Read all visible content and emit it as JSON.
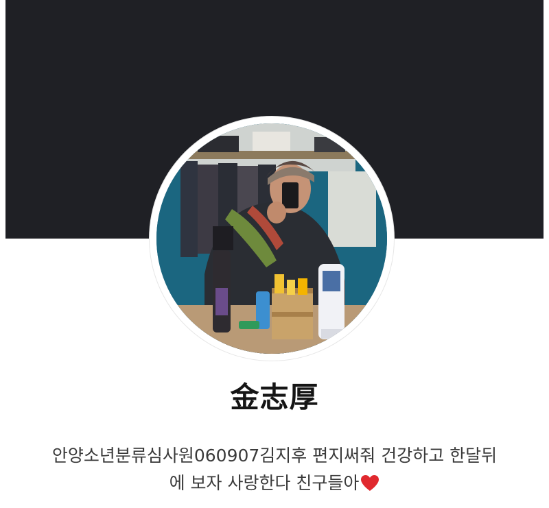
{
  "profile": {
    "name": "金志厚",
    "status_line_1": "안양소년분류심사원060907김지후 편지써줘 건강하고 한달뒤",
    "status_line_2": "에 보자 사랑한다 친구들아",
    "status_emoji": "heart-icon",
    "avatar": "avatar-photo"
  },
  "colors": {
    "cover": "#1f2025",
    "heart": "#e0282e",
    "name_text": "#151515",
    "status_text": "#3a3a3a"
  }
}
